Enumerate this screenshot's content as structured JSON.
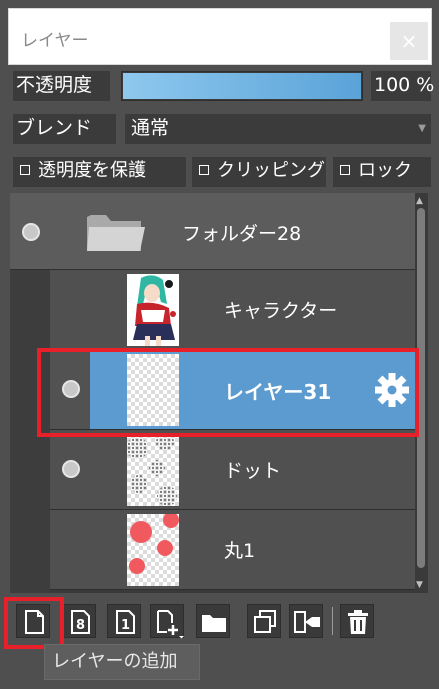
{
  "window": {
    "title": "レイヤー",
    "close_label": "×"
  },
  "opacity": {
    "label": "不透明度",
    "value": "100 %",
    "level": 1.0
  },
  "blend": {
    "label": "ブレンド",
    "value": "通常"
  },
  "checks": {
    "preserve_opacity": "透明度を保護",
    "clipping": "クリッピング",
    "lock": "ロック"
  },
  "layers": {
    "folder": {
      "name": "フォルダー28"
    },
    "items": [
      {
        "name": "キャラクター"
      },
      {
        "name": "レイヤー31",
        "selected": true
      },
      {
        "name": "ドット"
      },
      {
        "name": "丸1"
      }
    ]
  },
  "toolbar": {
    "buttons": [
      {
        "icon": "new-layer-icon"
      },
      {
        "icon": "new-8bit-layer-icon",
        "glyph": "8"
      },
      {
        "icon": "new-1bit-layer-icon",
        "glyph": "1"
      },
      {
        "icon": "add-layer-menu-icon"
      },
      {
        "icon": "new-folder-icon"
      },
      {
        "icon": "duplicate-layer-icon"
      },
      {
        "icon": "merge-down-icon"
      },
      {
        "icon": "delete-layer-icon"
      }
    ],
    "tooltip": "レイヤーの追加"
  },
  "colors": {
    "selected_row": "#5b9bd0",
    "highlight_frame": "#e8202a",
    "opacity_fill": "#7fb8e6"
  }
}
